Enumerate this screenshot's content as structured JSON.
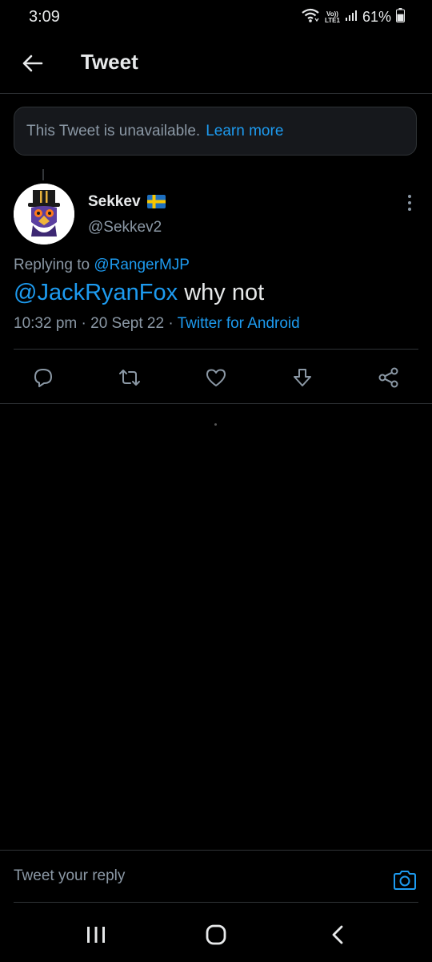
{
  "status_bar": {
    "time": "3:09",
    "network_label": "LTE1",
    "volte_label": "Vo))",
    "battery_percent": "61%",
    "battery_level": 0.61
  },
  "header": {
    "title": "Tweet"
  },
  "unavailable_notice": {
    "message": "This Tweet is unavailable.",
    "link_label": "Learn more"
  },
  "tweet": {
    "author_name": "Sekkev",
    "author_flag": "sweden-flag",
    "author_handle": "@Sekkev2",
    "replying_prefix": "Replying to",
    "replying_to": "@RangerMJP",
    "mention": "@JackRyanFox",
    "body": "why not",
    "time": "10:32 pm",
    "date": "20 Sept 22",
    "separator": "·",
    "source": "Twitter for Android"
  },
  "actions": [
    {
      "name": "reply-button",
      "icon": "comment-icon"
    },
    {
      "name": "retweet-button",
      "icon": "retweet-icon"
    },
    {
      "name": "like-button",
      "icon": "heart-icon"
    },
    {
      "name": "downvote-button",
      "icon": "down-arrow-icon"
    },
    {
      "name": "share-button",
      "icon": "share-icon"
    }
  ],
  "reply_bar": {
    "placeholder": "Tweet your reply"
  },
  "colors": {
    "background": "#000000",
    "text": "#e7e9ea",
    "muted": "#8b98a5",
    "accent": "#1d9bf0",
    "border": "#2f3336"
  }
}
